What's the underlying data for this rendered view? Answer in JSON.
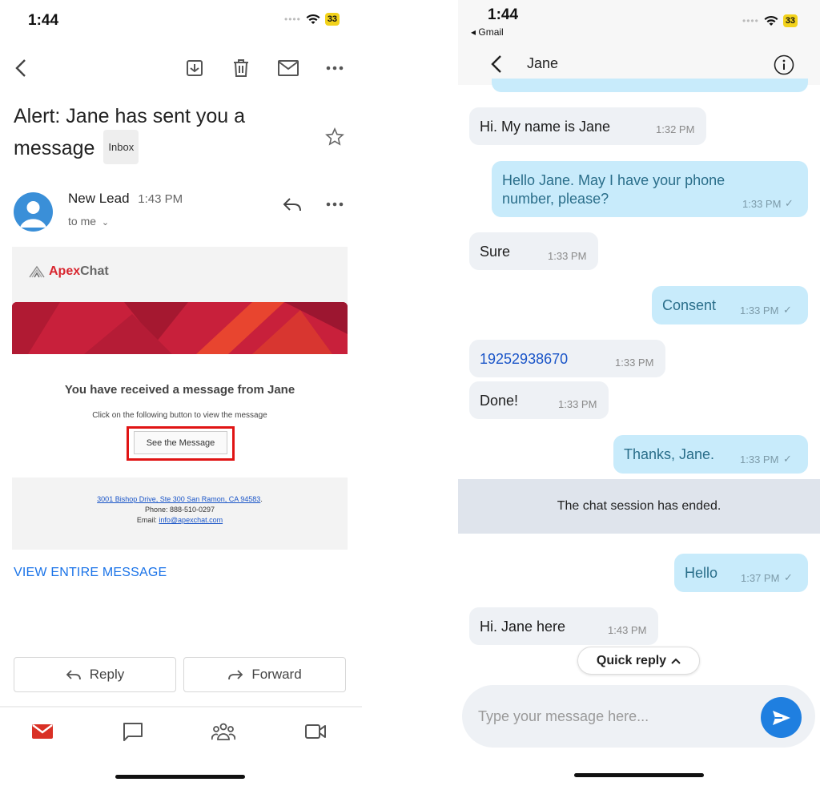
{
  "gmail": {
    "status": {
      "time": "1:44",
      "battery": "33"
    },
    "subject": "Alert: Jane  has sent you a message",
    "inbox_label": "Inbox",
    "sender": "New Lead",
    "sent_time": "1:43 PM",
    "to_me": "to me",
    "email": {
      "logo_prefix": "Apex",
      "logo_suffix": "Chat",
      "headline": "You have received a message from Jane",
      "subline": "Click on the following button to view the message",
      "button": "See the Message",
      "address": "3001 Bishop Drive, Ste 300 San Ramon, CA 94583",
      "address_end": ".",
      "phone": "Phone: 888-510-0297",
      "email_label": "Email: ",
      "email_link": "info@apexchat.com"
    },
    "view_entire": "VIEW ENTIRE MESSAGE",
    "reply": "Reply",
    "forward": "Forward"
  },
  "chat": {
    "status": {
      "time": "1:44",
      "battery": "33",
      "back_app": "◂ Gmail"
    },
    "title": "Jane",
    "messages": [
      {
        "text": "Hi. My name is Jane",
        "time": "1:32 PM"
      },
      {
        "text_line1": "Hello Jane. May I have your phone",
        "text_line2": "number, please?",
        "time": "1:33 PM"
      },
      {
        "text": "Sure",
        "time": "1:33 PM"
      },
      {
        "text": "Consent",
        "time": "1:33 PM"
      },
      {
        "text": "19252938670",
        "time": "1:33 PM"
      },
      {
        "text": "Done!",
        "time": "1:33 PM"
      },
      {
        "text": "Thanks, Jane.",
        "time": "1:33 PM"
      },
      {
        "text": "Hello",
        "time": "1:37 PM"
      },
      {
        "text": "Hi. Jane here",
        "time": "1:43 PM"
      }
    ],
    "session_ended": "The chat session has ended.",
    "quick_reply": "Quick reply",
    "compose_placeholder": "Type your message here..."
  },
  "colors": {
    "gmail_link": "#1a73e8",
    "highlight_box": "#e01414",
    "outgoing_bubble": "#c8ebfb",
    "incoming_bubble": "#eef1f5",
    "send_button": "#1f7fe0"
  }
}
